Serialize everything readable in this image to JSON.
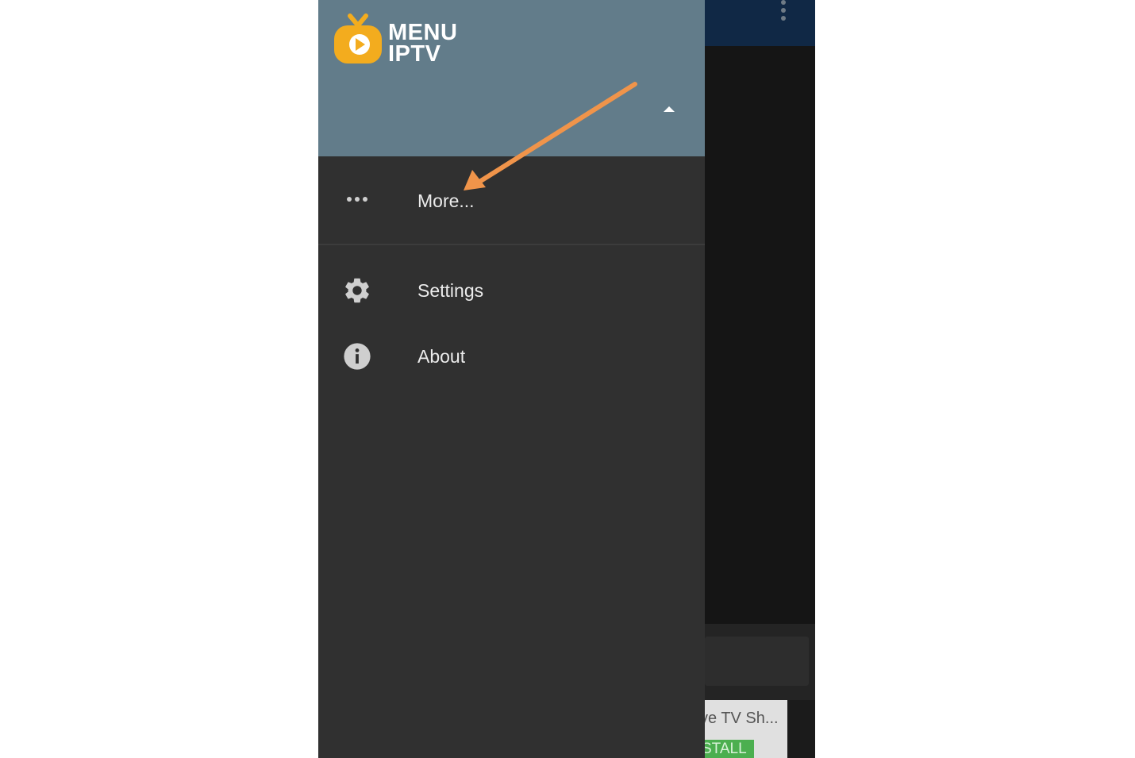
{
  "app": {
    "brand_line1": "MENU",
    "brand_line2": "IPTV",
    "logo_icon": "tv-play-icon",
    "brand_color": "#f3ac1e",
    "header_color": "#627c8a",
    "drawer_color": "#303030"
  },
  "drawer": {
    "more_label": "More...",
    "more_icon": "more-horizontal-icon",
    "items": [
      {
        "label": "Settings",
        "icon": "gear-icon"
      },
      {
        "label": "About",
        "icon": "info-icon"
      }
    ]
  },
  "background": {
    "card_title": "ve TV Sh...",
    "card_button": "STALL"
  },
  "annotation": {
    "arrow_color": "#f0944a",
    "arrow_target": "More..."
  }
}
